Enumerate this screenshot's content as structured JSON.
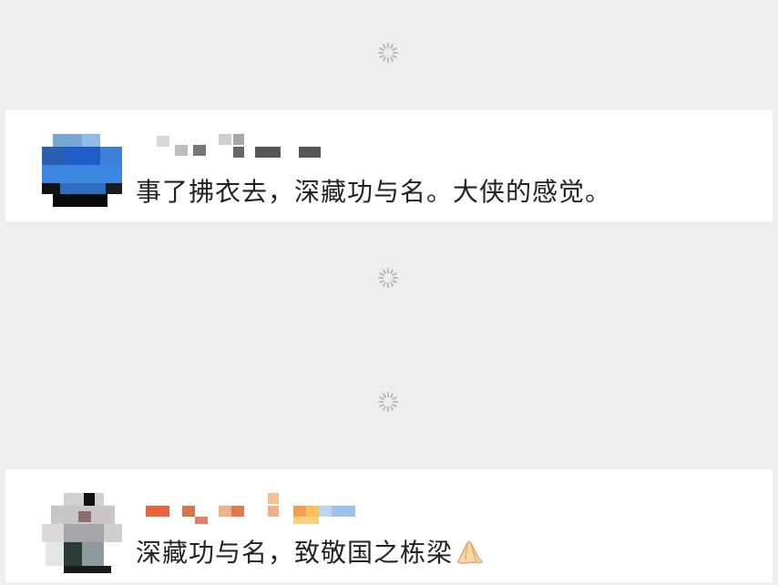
{
  "comments": [
    {
      "author": "",
      "text": "事了拂衣去，深藏功与名。大侠的感觉。"
    },
    {
      "author": "",
      "text": "深藏功与名，致敬国之栋梁",
      "emoji": "hands-icon"
    }
  ],
  "colors": {
    "background": "#efeeee",
    "card": "#ffffff",
    "text": "#222222",
    "spinner": "#b9b9b9"
  }
}
